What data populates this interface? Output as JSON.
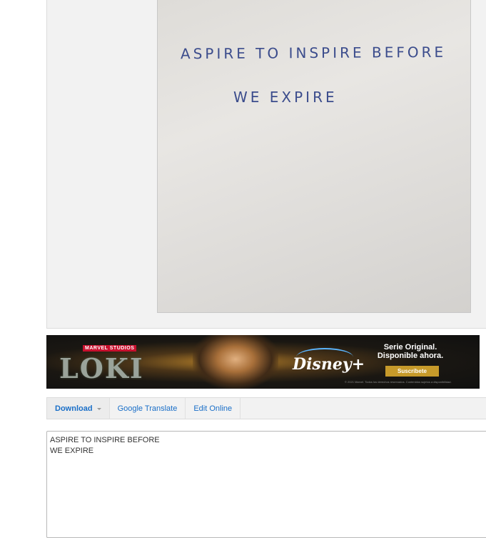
{
  "photo": {
    "line1": "ASPIRE TO INSPIRE BEFORE",
    "line2": "WE EXPIRE"
  },
  "ad": {
    "badge": "MARVEL STUDIOS",
    "logo": "LOKI",
    "brand": "Disney+",
    "headline_1": "Serie Original.",
    "headline_2": "Disponible ahora.",
    "cta": "Suscríbete",
    "legal": "© 2021 Marvel. Todos los derechos reservados. Contenidos sujetos a disponibilidad."
  },
  "toolbar": {
    "download": "Download",
    "translate": "Google Translate",
    "edit": "Edit Online"
  },
  "result": {
    "text": "ASPIRE TO INSPIRE BEFORE\nWE EXPIRE"
  }
}
